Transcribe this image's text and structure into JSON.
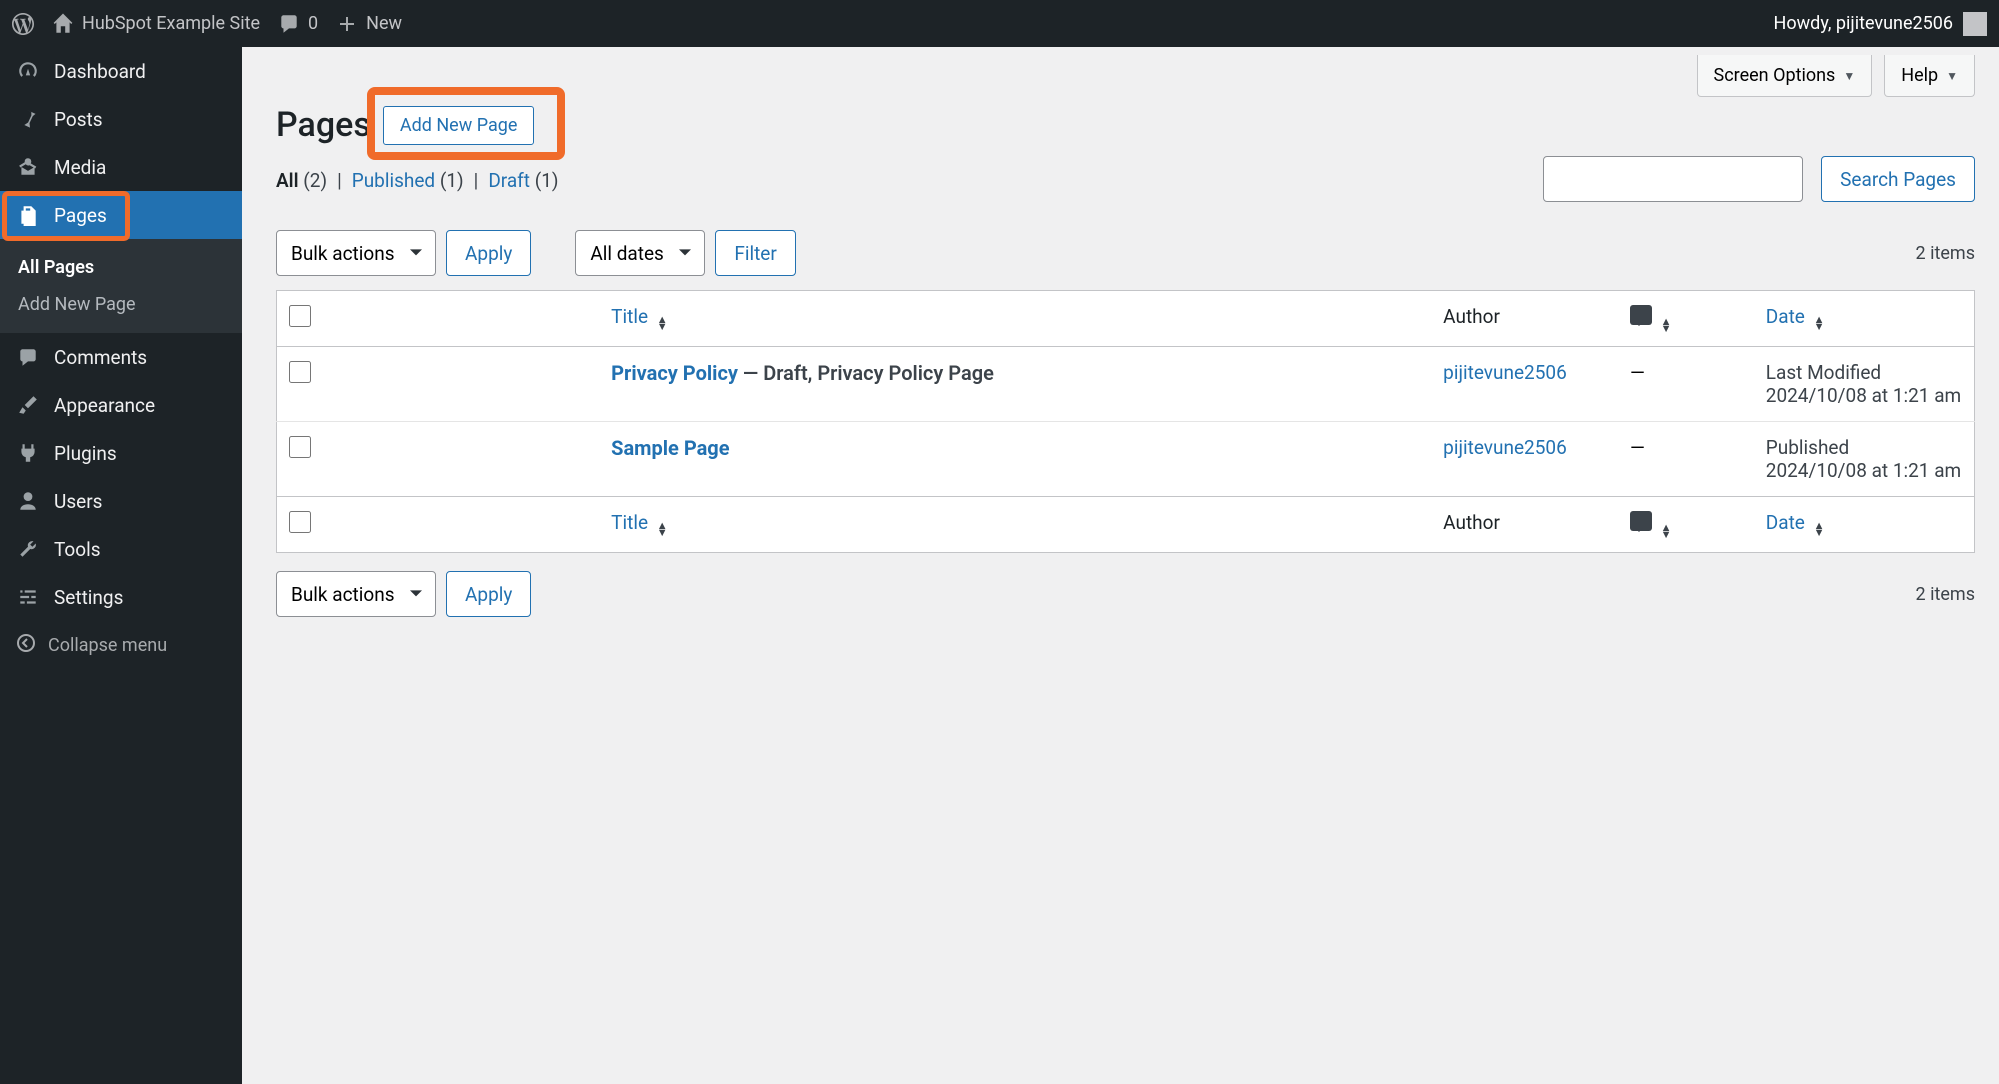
{
  "adminbar": {
    "site_name": "HubSpot Example Site",
    "comments_count": "0",
    "new_label": "New",
    "howdy": "Howdy, pijitevune2506"
  },
  "sidebar": {
    "items": [
      {
        "label": "Dashboard",
        "icon": "dashboard"
      },
      {
        "label": "Posts",
        "icon": "pin"
      },
      {
        "label": "Media",
        "icon": "media"
      },
      {
        "label": "Pages",
        "icon": "page",
        "current": true
      },
      {
        "label": "Comments",
        "icon": "comment"
      },
      {
        "label": "Appearance",
        "icon": "brush"
      },
      {
        "label": "Plugins",
        "icon": "plug"
      },
      {
        "label": "Users",
        "icon": "user"
      },
      {
        "label": "Tools",
        "icon": "wrench"
      },
      {
        "label": "Settings",
        "icon": "sliders"
      }
    ],
    "submenu": [
      {
        "label": "All Pages",
        "current": true
      },
      {
        "label": "Add New Page"
      }
    ],
    "collapse_label": "Collapse menu"
  },
  "topright": {
    "screen_options": "Screen Options",
    "help": "Help"
  },
  "heading": {
    "title": "Pages",
    "add_new": "Add New Page"
  },
  "filters": {
    "all_label": "All",
    "all_count": "(2)",
    "published_label": "Published",
    "published_count": "(1)",
    "draft_label": "Draft",
    "draft_count": "(1)"
  },
  "search": {
    "button": "Search Pages"
  },
  "bulk": {
    "actions_label": "Bulk actions",
    "apply_label": "Apply",
    "dates_label": "All dates",
    "filter_label": "Filter"
  },
  "items_count": "2 items",
  "table": {
    "columns": {
      "title": "Title",
      "author": "Author",
      "date": "Date"
    },
    "rows": [
      {
        "title": "Privacy Policy",
        "suffix": " — Draft, Privacy Policy Page",
        "author": "pijitevune2506",
        "comments": "—",
        "date_label": "Last Modified",
        "date_value": "2024/10/08 at 1:21 am"
      },
      {
        "title": "Sample Page",
        "suffix": "",
        "author": "pijitevune2506",
        "comments": "—",
        "date_label": "Published",
        "date_value": "2024/10/08 at 1:21 am"
      }
    ]
  }
}
